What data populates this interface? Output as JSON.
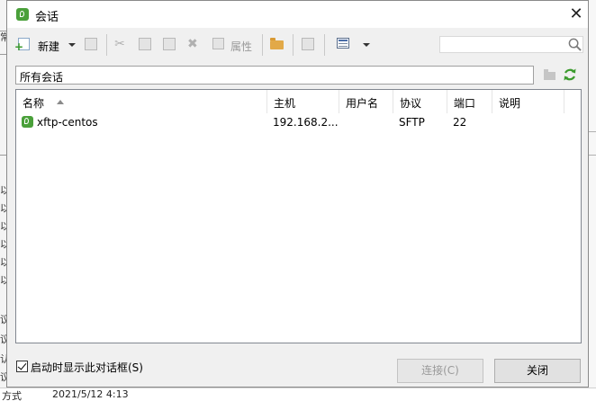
{
  "dialog": {
    "title": "会话",
    "close_glyph": "✕"
  },
  "toolbar": {
    "new_label": "新建",
    "properties_label": "属性",
    "search_placeholder": ""
  },
  "path_bar": {
    "text": "所有会话"
  },
  "table": {
    "columns": [
      "名称",
      "主机",
      "用户名",
      "协议",
      "端口",
      "说明"
    ],
    "rows": [
      {
        "name": "xftp-centos",
        "host": "192.168.2...",
        "user": "",
        "protocol": "SFTP",
        "port": "22",
        "description": ""
      }
    ]
  },
  "footer": {
    "show_on_startup_label": "启动时显示此对话框(S)",
    "show_on_startup_checked": true,
    "connect_label": "连接(C)",
    "close_label": "关闭"
  },
  "background": {
    "left_chars": [
      "常",
      "以",
      "以",
      "以",
      "以",
      "以",
      "以",
      "议",
      "议",
      "认",
      "议"
    ],
    "bottom_left_text": "方式",
    "bottom_date_text": "2021/5/12  4:13"
  },
  "colors": {
    "accent_green": "#4aa03a",
    "folder_orange": "#e2a948"
  }
}
